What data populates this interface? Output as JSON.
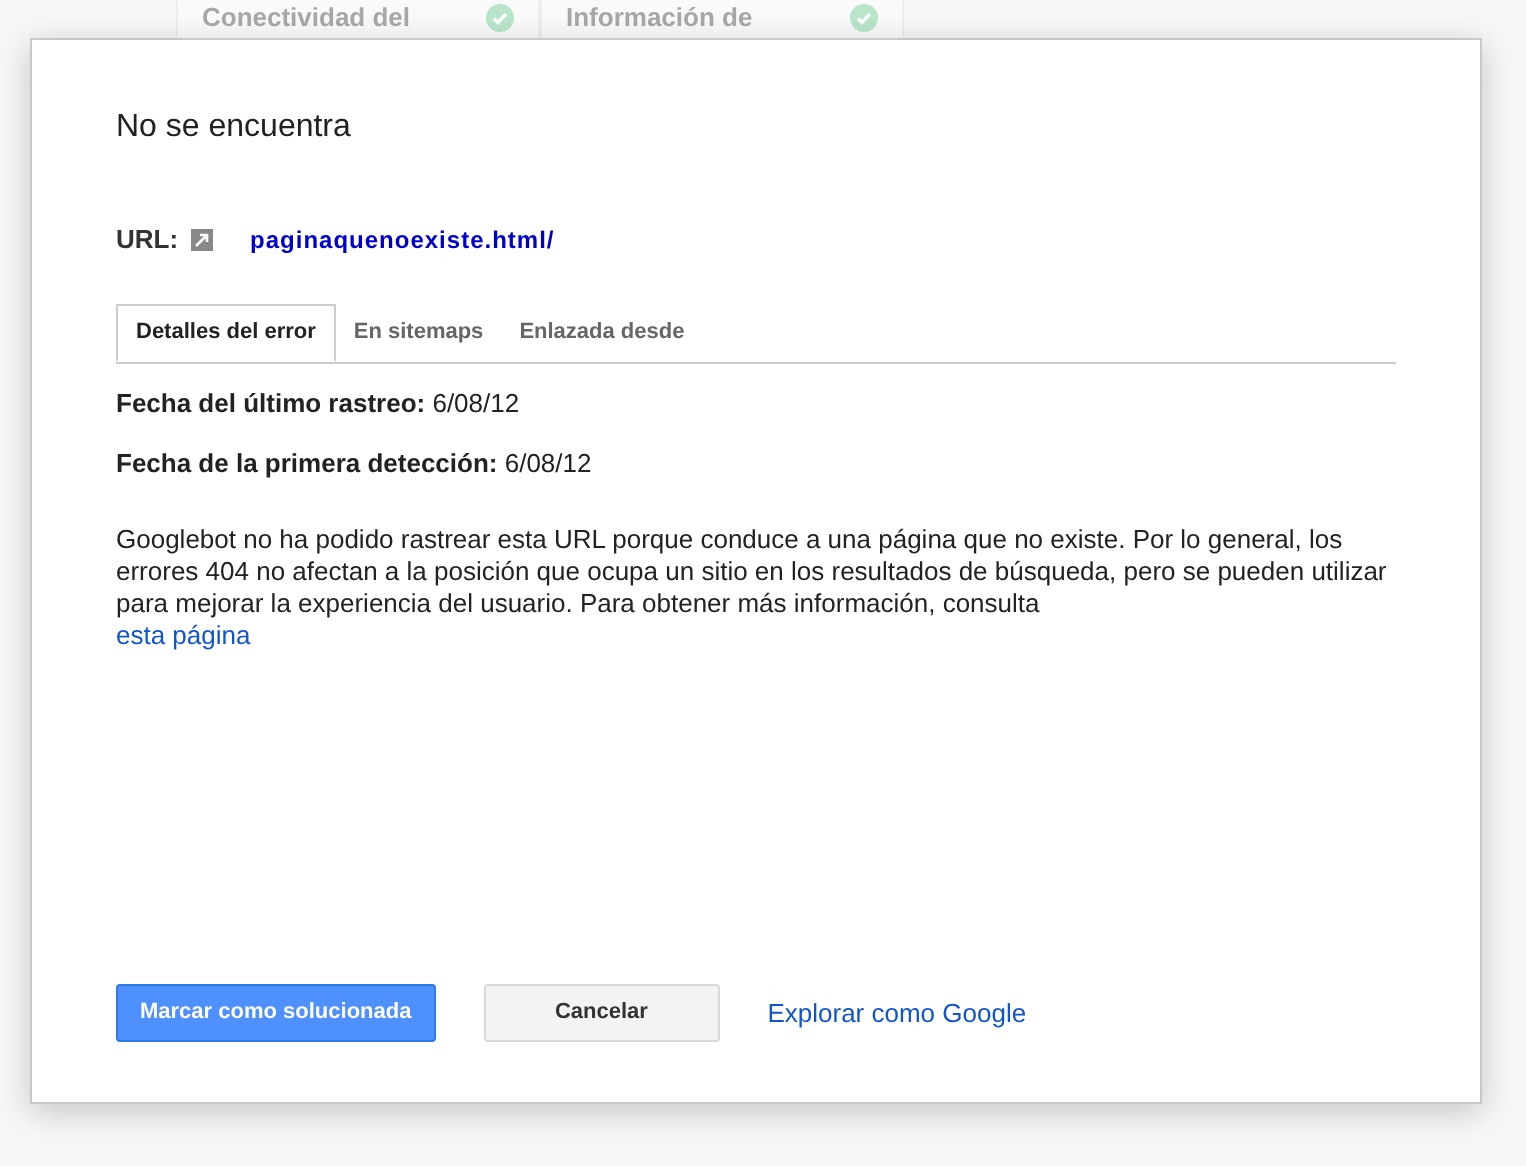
{
  "background": {
    "cards": [
      {
        "title": "Conectividad del",
        "ok": true
      },
      {
        "title": "Información de",
        "ok": true
      }
    ]
  },
  "dialog": {
    "title": "No se encuentra",
    "url": {
      "label": "URL:",
      "value": "paginaquenoexiste.html/"
    },
    "tabs": [
      {
        "label": "Detalles del error",
        "selected": true
      },
      {
        "label": "En sitemaps",
        "selected": false
      },
      {
        "label": "Enlazada desde",
        "selected": false
      }
    ],
    "facts": [
      {
        "label": "Fecha del último rastreo:",
        "value": "6/08/12"
      },
      {
        "label": "Fecha de la primera detección:",
        "value": "6/08/12"
      }
    ],
    "description": "Googlebot no ha podido rastrear esta URL porque conduce a una página que no existe. Por lo general, los errores 404 no afectan a la posición que ocupa un sitio en los resultados de búsqueda, pero se pueden utilizar para mejorar la experiencia del usuario. Para obtener más información, consulta",
    "link": "esta página",
    "buttons": {
      "primary": "Marcar como solucionada",
      "secondary": "Cancelar",
      "link": "Explorar como Google"
    }
  }
}
